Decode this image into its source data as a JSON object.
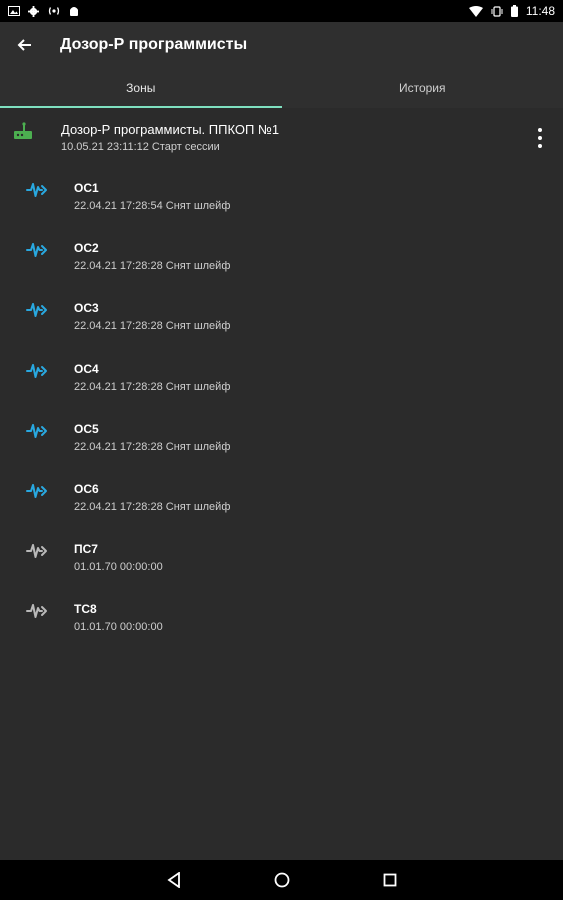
{
  "status_bar": {
    "time": "11:48",
    "left_icons": [
      "image-icon",
      "gear-icon",
      "signal-icon",
      "android-icon"
    ],
    "right_icons": [
      "wifi-icon",
      "vibrate-icon",
      "battery-icon"
    ]
  },
  "toolbar": {
    "title": "Дозор-Р программисты",
    "back_icon": "arrow-back-icon"
  },
  "tabs": [
    {
      "label": "Зоны",
      "active": true
    },
    {
      "label": "История",
      "active": false
    }
  ],
  "device": {
    "title": "Дозор-Р программисты. ППКОП №1",
    "subtitle": "10.05.21 23:11:12 Старт сессии",
    "icon": "router-icon",
    "icon_color": "#4caf50"
  },
  "zones": [
    {
      "name": "ОС1",
      "status": "22.04.21 17:28:54 Снят шлейф",
      "icon_color": "#29a8e0"
    },
    {
      "name": "ОС2",
      "status": "22.04.21 17:28:28 Снят шлейф",
      "icon_color": "#29a8e0"
    },
    {
      "name": "ОС3",
      "status": "22.04.21 17:28:28 Снят шлейф",
      "icon_color": "#29a8e0"
    },
    {
      "name": "ОС4",
      "status": "22.04.21 17:28:28 Снят шлейф",
      "icon_color": "#29a8e0"
    },
    {
      "name": "ОС5",
      "status": "22.04.21 17:28:28 Снят шлейф",
      "icon_color": "#29a8e0"
    },
    {
      "name": "ОС6",
      "status": "22.04.21 17:28:28 Снят шлейф",
      "icon_color": "#29a8e0"
    },
    {
      "name": "ПС7",
      "status": "01.01.70 00:00:00",
      "icon_color": "#b8b8b8"
    },
    {
      "name": "ТС8",
      "status": "01.01.70 00:00:00",
      "icon_color": "#b8b8b8"
    }
  ],
  "colors": {
    "accent": "#7fe0c0",
    "toolbar_bg": "#2f2f2f",
    "content_bg": "#2b2b2b"
  },
  "nav_bar": [
    "back-triangle-icon",
    "home-circle-icon",
    "recents-square-icon"
  ]
}
